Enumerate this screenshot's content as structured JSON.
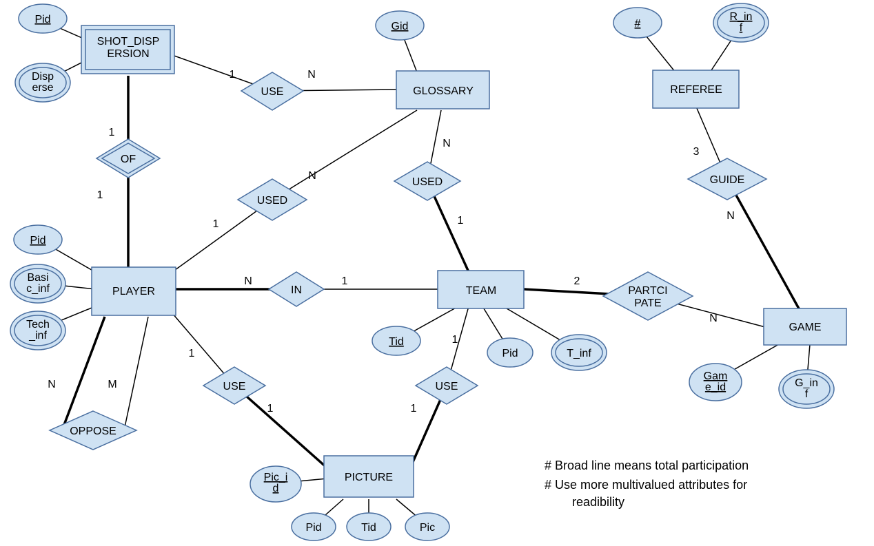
{
  "entities": {
    "shot_dispersion": "SHOT_DISPERSION",
    "glossary": "GLOSSARY",
    "referee": "REFEREE",
    "player": "PLAYER",
    "team": "TEAM",
    "game": "GAME",
    "picture": "PICTURE"
  },
  "relationships": {
    "use_sd_gl": "USE",
    "of": "OF",
    "used_pl_gl": "USED",
    "used_tm_gl": "USED",
    "in": "IN",
    "participate": "PARTCIPATE",
    "guide": "GUIDE",
    "use_pl_pic": "USE",
    "use_tm_pic": "USE",
    "oppose": "OPPOSE"
  },
  "attributes": {
    "sd_pid": "Pid",
    "disperse1": "Disp",
    "disperse2": "erse",
    "gid": "Gid",
    "ref_num": "#",
    "r_inf1": "R_in",
    "r_inf2": "f",
    "pl_pid": "Pid",
    "basic1": "Basi",
    "basic2": "c_inf",
    "tech1": "Tech",
    "tech2": "_inf",
    "tid": "Tid",
    "tm_pid": "Pid",
    "t_inf": "T_inf",
    "game_id1": "Gam",
    "game_id2": "e_id",
    "g_inf1": "G_in",
    "g_inf2": "f",
    "pic_id1": "Pic_i",
    "pic_id2": "d",
    "pic_pid": "Pid",
    "pic_tid": "Tid",
    "pic_pic": "Pic"
  },
  "cards": {
    "sd_use_1": "1",
    "sd_use_n": "N",
    "of_top": "1",
    "of_bot": "1",
    "used_pl_1": "1",
    "used_pl_n": "N",
    "used_tm_n": "N",
    "used_tm_1": "1",
    "in_n": "N",
    "in_1": "1",
    "part_2": "2",
    "part_n": "N",
    "guide_3": "3",
    "guide_n": "N",
    "oppose_n": "N",
    "oppose_m": "M",
    "use_pl_pic_top": "1",
    "use_pl_pic_bot": "1",
    "use_tm_pic_top": "1",
    "use_tm_pic_bot": "1"
  },
  "notes": {
    "line1": "# Broad line means  total participation",
    "line2": "# Use more multivalued attributes for",
    "line2b": "readibility"
  }
}
